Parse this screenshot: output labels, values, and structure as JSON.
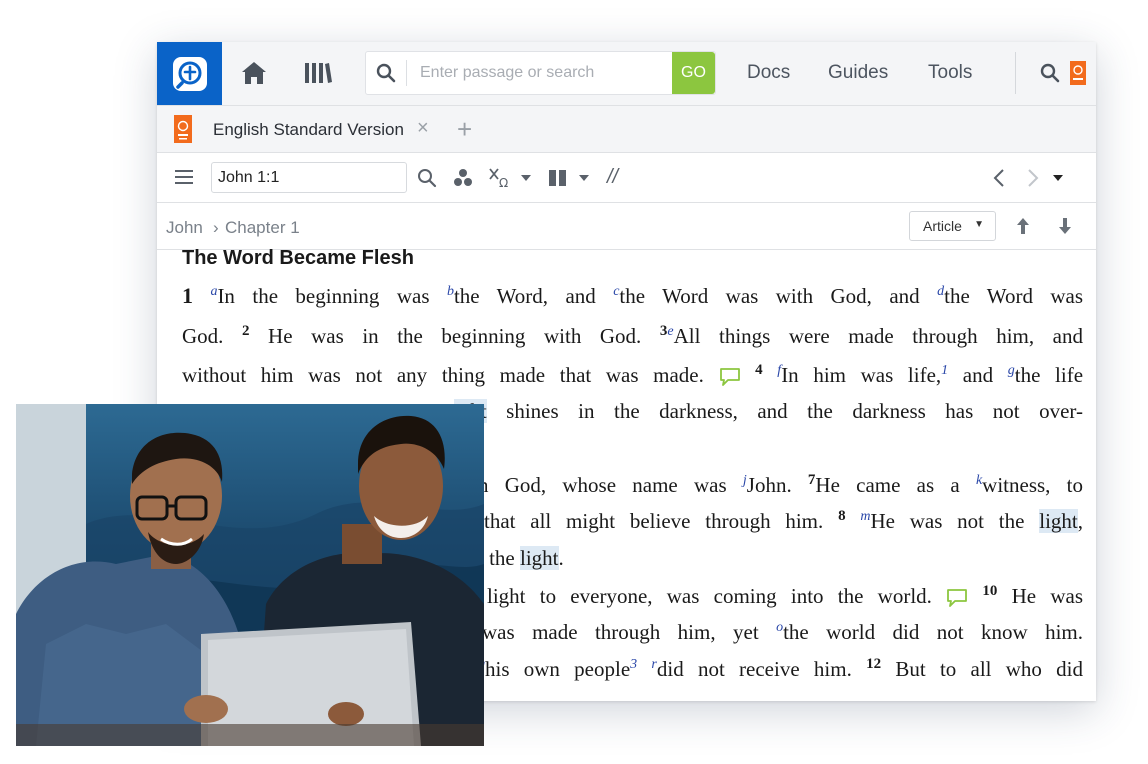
{
  "topbar": {
    "search_placeholder": "Enter passage or search",
    "go_label": "GO",
    "nav": [
      "Docs",
      "Guides",
      "Tools"
    ]
  },
  "tab": {
    "title": "English Standard Version",
    "close": "×",
    "add": "+"
  },
  "toolbar": {
    "reference_value": "John 1:1",
    "parallel_symbol": "//"
  },
  "breadcrumb": {
    "book": "John",
    "separator": "›",
    "chapter": "Chapter 1",
    "view_button": "Article"
  },
  "passage": {
    "heading": "The Word Became Flesh",
    "lines": [
      {
        "segs": [
          [
            "v",
            "1"
          ],
          [
            "t",
            " "
          ],
          [
            "f",
            "a"
          ],
          [
            "t",
            "In the beginning was "
          ],
          [
            "f",
            "b"
          ],
          [
            "t",
            "the Word, and "
          ],
          [
            "f",
            "c"
          ],
          [
            "t",
            "the Word was with God, and "
          ],
          [
            "f",
            "d"
          ],
          [
            "t",
            "the Word was"
          ]
        ]
      },
      {
        "segs": [
          [
            "t",
            "God. "
          ],
          [
            "n",
            "2"
          ],
          [
            "t",
            " He was in the beginning with God. "
          ],
          [
            "n",
            "3"
          ],
          [
            "f",
            "e"
          ],
          [
            "t",
            "All things were made through him, and"
          ]
        ]
      },
      {
        "segs": [
          [
            "t",
            "without him was not any thing made that was made. "
          ],
          [
            "c",
            ""
          ],
          [
            "t",
            " "
          ],
          [
            "n",
            "4"
          ],
          [
            "t",
            " "
          ],
          [
            "f",
            "f"
          ],
          [
            "t",
            "In him was life,"
          ],
          [
            "f",
            "1"
          ],
          [
            "t",
            " and "
          ],
          [
            "f",
            "g"
          ],
          [
            "t",
            "the life"
          ]
        ]
      },
      {
        "segs": [
          [
            "h",
            "ight"
          ],
          [
            "t",
            " shines in the darkness, and the darkness has not over-"
          ]
        ]
      },
      {
        "segs": [
          [
            "t",
            "n God, whose name was "
          ],
          [
            "f",
            "j"
          ],
          [
            "t",
            "John. "
          ],
          [
            "n",
            "7"
          ],
          [
            "t",
            "He came as a "
          ],
          [
            "f",
            "k"
          ],
          [
            "t",
            "witness, to"
          ]
        ]
      },
      {
        "segs": [
          [
            "t",
            "that all might believe through him. "
          ],
          [
            "n",
            "8"
          ],
          [
            "t",
            " "
          ],
          [
            "f",
            "m"
          ],
          [
            "t",
            "He was not the "
          ],
          [
            "h",
            "light"
          ],
          [
            "t",
            ","
          ]
        ]
      },
      {
        "segs": [
          [
            "t",
            "t the "
          ],
          [
            "h",
            "light"
          ],
          [
            "t",
            "."
          ]
        ]
      },
      {
        "segs": [
          [
            "t",
            "light to everyone, was coming into the world. "
          ],
          [
            "c",
            ""
          ],
          [
            "t",
            " "
          ],
          [
            "n",
            "10"
          ],
          [
            "t",
            " He was"
          ]
        ]
      },
      {
        "segs": [
          [
            "t",
            "was made through him, yet "
          ],
          [
            "f",
            "o"
          ],
          [
            "t",
            "the world did not know him."
          ]
        ]
      },
      {
        "segs": [
          [
            "f",
            "q"
          ],
          [
            "t",
            "his own people"
          ],
          [
            "f",
            "3"
          ],
          [
            "t",
            " "
          ],
          [
            "f",
            "r"
          ],
          [
            "t",
            "did not receive him. "
          ],
          [
            "n",
            "12"
          ],
          [
            "t",
            " But to all who did"
          ]
        ]
      }
    ]
  }
}
